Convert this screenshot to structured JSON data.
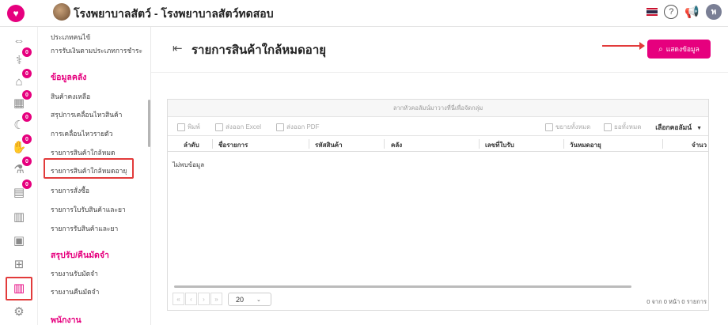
{
  "header": {
    "clinic_title": "โรงพยาบาลสัตว์ - โรงพยาบาลสัตว์ทดสอบ",
    "user_initial": "พ",
    "help_symbol": "?",
    "flag_colors": [
      "#c8102e",
      "#ffffff",
      "#2d2a4a",
      "#ffffff",
      "#c8102e"
    ]
  },
  "rail": {
    "items": [
      {
        "icon": "heart-logo-icon",
        "glyph": "♥",
        "badge": ""
      },
      {
        "icon": "dumbbell-icon",
        "glyph": "⇔",
        "badge": ""
      },
      {
        "icon": "stethoscope-icon",
        "glyph": "⚕",
        "badge": "0"
      },
      {
        "icon": "bed-icon",
        "glyph": "⌂",
        "badge": "0"
      },
      {
        "icon": "calendar-icon",
        "glyph": "▦",
        "badge": "0"
      },
      {
        "icon": "moon-icon",
        "glyph": "☾",
        "badge": "0"
      },
      {
        "icon": "hand-icon",
        "glyph": "✋",
        "badge": "0"
      },
      {
        "icon": "pill-icon",
        "glyph": "⚗",
        "badge": "0"
      },
      {
        "icon": "invoice-icon",
        "glyph": "▤",
        "badge": "0"
      },
      {
        "icon": "register-icon",
        "glyph": "▥",
        "badge": ""
      },
      {
        "icon": "box-icon",
        "glyph": "▣",
        "badge": ""
      },
      {
        "icon": "grid-icon",
        "glyph": "⊞",
        "badge": ""
      },
      {
        "icon": "report-chart-icon",
        "glyph": "▥",
        "badge": ""
      },
      {
        "icon": "settings-icon",
        "glyph": "⚙",
        "badge": ""
      }
    ]
  },
  "submenu": {
    "items_top": [
      "ประเภทคนไข้",
      "การรับเงินตามประเภทการชำระ"
    ],
    "section_inventory": "ข้อมูลคลัง",
    "inventory_items": [
      "สินค้าคงเหลือ",
      "สรุปการเคลื่อนไหวสินค้า",
      "การเคลื่อนไหวรายตัว",
      "รายการสินค้าใกล้หมด",
      "รายการสินค้าใกล้หมดอายุ",
      "รายการสั่งซื้อ",
      "รายการใบรับสินค้าและยา",
      "รายการรับสินค้าและยา"
    ],
    "section_receive_pay": "สรุปรับ/คืนมัดจำ",
    "receive_pay_items": [
      "รายงานรับมัดจำ",
      "รายงานคืนมัดจำ"
    ],
    "section_staff": "พนักงาน"
  },
  "page": {
    "title": "รายการสินค้าใกล้หมดอายุ",
    "show_button": "แสดงข้อมูล"
  },
  "grid": {
    "group_panel": "ลากหัวคอลัมน์มาวางที่นี่เพื่อจัดกลุ่ม",
    "toolbar": {
      "print": "พิมพ์",
      "export_excel": "ส่งออก Excel",
      "export_pdf": "ส่งออก PDF",
      "expand_all": "ขยายทั้งหมด",
      "collapse_all": "ยอทั้งหมด",
      "choose_columns": "เลือกคอลัมน์"
    },
    "columns": [
      "ลำดับ",
      "ชื่อรายการ",
      "รหัสสินค้า",
      "คลัง",
      "เลขที่ใบรับ",
      "วันหมดอายุ",
      "จำนว"
    ],
    "no_data": "ไม่พบข้อมูล",
    "pager_buttons": [
      "«",
      "‹",
      "›",
      "»"
    ],
    "page_size": "20",
    "page_info": "0 จาก 0 หน้า 0 รายการ"
  }
}
